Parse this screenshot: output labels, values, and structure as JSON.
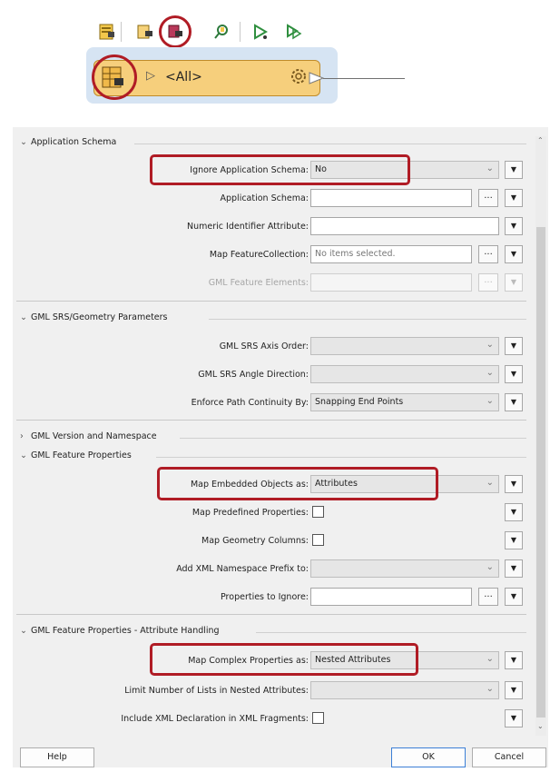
{
  "toolbar": {
    "icons": [
      "reader-table-icon",
      "writer-icon",
      "feature-type-icon",
      "search-icon",
      "run-icon",
      "run-step-icon"
    ]
  },
  "node": {
    "label": "<All>"
  },
  "sections": {
    "app_schema": "Application Schema",
    "srs": "GML SRS/Geometry Parameters",
    "version": "GML Version and Namespace",
    "feature_props": "GML Feature Properties",
    "attr_handling": "GML Feature Properties - Attribute Handling"
  },
  "fields": {
    "ignore_app_schema": {
      "label": "Ignore Application Schema:",
      "value": "No"
    },
    "application_schema": {
      "label": "Application Schema:"
    },
    "numeric_id": {
      "label": "Numeric Identifier Attribute:"
    },
    "map_feature_collection": {
      "label": "Map FeatureCollection:",
      "placeholder": "No items selected."
    },
    "gml_feature_elements": {
      "label": "GML Feature Elements:"
    },
    "srs_axis_order": {
      "label": "GML SRS Axis Order:"
    },
    "srs_angle_direction": {
      "label": "GML SRS Angle Direction:"
    },
    "enforce_path": {
      "label": "Enforce Path Continuity By:",
      "value": "Snapping End Points"
    },
    "map_embedded": {
      "label": "Map Embedded Objects as:",
      "value": "Attributes"
    },
    "map_predefined": {
      "label": "Map Predefined Properties:"
    },
    "map_geometry_columns": {
      "label": "Map Geometry Columns:"
    },
    "add_xml_ns": {
      "label": "Add XML Namespace Prefix to:"
    },
    "props_ignore": {
      "label": "Properties to Ignore:"
    },
    "map_complex": {
      "label": "Map Complex Properties as:",
      "value": "Nested Attributes"
    },
    "limit_lists": {
      "label": "Limit Number of Lists in Nested Attributes:"
    },
    "include_xml_decl": {
      "label": "Include XML Declaration in XML Fragments:"
    }
  },
  "buttons": {
    "help": "Help",
    "ok": "OK",
    "cancel": "Cancel"
  },
  "colors": {
    "highlight": "#b01c25",
    "node_fill": "#f6cf7c",
    "node_band": "#d6e4f3"
  }
}
